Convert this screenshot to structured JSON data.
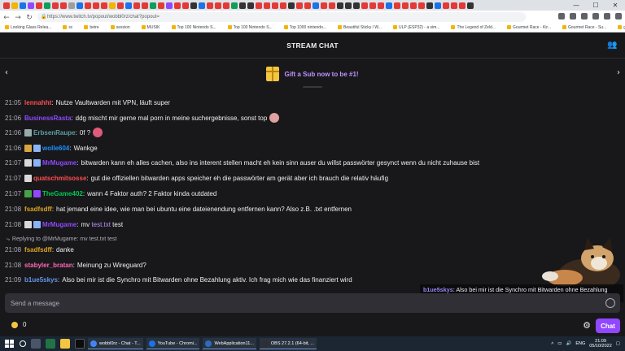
{
  "browser": {
    "url": "https://www.twitch.tv/popout/wobbl0rz/chat?popout=",
    "bookmarks": [
      "Looking Glass Relea...",
      "sc",
      "betre",
      "session",
      "MUSIK",
      "Top 100 Nintendo S...",
      "Top 100 Nintendo S...",
      "Top 1000 nintendo...",
      "Beautiful Sticky / W...",
      "ULP (ESP32) - a sim...",
      "The Legend of Zeld...",
      "Gourmet Race - Kir...",
      "Gourmet Race - Su...",
      "gachibass gif - Goo..."
    ]
  },
  "header": {
    "title": "STREAM CHAT"
  },
  "banner": {
    "text": "Gift a Sub now to be #1!"
  },
  "messages": [
    {
      "time": "21:05",
      "user": "lennahht",
      "color": "#ff4d4d",
      "text": "Nutze Vaultwarden mit VPN, läuft super",
      "badges": []
    },
    {
      "time": "21:06",
      "user": "BusinessRasta",
      "color": "#9147ff",
      "text": "ddg mischt mir gerne mal porn in meine suchergebnisse, sonst top",
      "badges": [],
      "emote": "#e0a0a0"
    },
    {
      "time": "21:06",
      "user": "ErbsenRaupe",
      "color": "#5f9ea0",
      "text": "0f ?",
      "badges": [
        "#9aa"
      ],
      "emote": "#e05a7a"
    },
    {
      "time": "21:06",
      "user": "wolle604",
      "color": "#1e90ff",
      "text": "Wankge",
      "badges": [
        "#d9a441",
        "#8ab4f8"
      ]
    },
    {
      "time": "21:07",
      "user": "MrMugame",
      "color": "#9147ff",
      "text": "bitwarden kann eh alles cachen, also ins interent stellen macht eh kein sinn auser du willst passwörter gesynct wenn du nicht zuhause bist",
      "badges": [
        "#d9d9d9",
        "#8ab4f8"
      ]
    },
    {
      "time": "21:07",
      "user": "quatschmitsosse",
      "color": "#ff4d4d",
      "text": "gut die offiziellen bitwarden apps speicher eh die passwörter am gerät aber ich brauch die relativ häufig",
      "badges": [
        "#d9d9d9"
      ]
    },
    {
      "time": "21:07",
      "user": "TheGame402",
      "color": "#00c853",
      "text": "wann 4 Faktor auth? 2 Faktor kinda outdated",
      "badges": [
        "#45a245",
        "#9147ff"
      ]
    },
    {
      "time": "21:08",
      "user": "fsadfsdff",
      "color": "#daa520",
      "text": "hat jemand eine idee, wie man bei ubuntu eine dateienendung entfernen kann? Also z.B. .txt entfernen",
      "badges": []
    },
    {
      "time": "21:08",
      "user": "MrMugame",
      "color": "#9147ff",
      "text_pre": "mv ",
      "link": "test.txt",
      "text_post": " test",
      "badges": [
        "#d9d9d9",
        "#8ab4f8"
      ]
    },
    {
      "time": "21:08",
      "user": "fsadfsdff",
      "color": "#daa520",
      "text": "danke",
      "badges": [],
      "reply": "Replying to @MrMugame: mv test.txt test"
    },
    {
      "time": "21:08",
      "user": "stabyler_bratan",
      "color": "#ff69b4",
      "text": "Meinung zu Wireguard?",
      "badges": []
    },
    {
      "time": "21:09",
      "user": "b1ue5skys",
      "color": "#6495ed",
      "text": "Also bei mir ist die Synchro mit Bitwarden ohne Bezahlung aktiv. Ich frag mich wie das finanziert wird",
      "badges": []
    }
  ],
  "tooltip": {
    "user": "b1ue5skys",
    "text": ": Also bei mir ist die Synchro mit Bitwarden ohne Bezahlung aktiv. Ich frag mich wie das finanziert wird"
  },
  "input": {
    "placeholder": "Send a message"
  },
  "footer": {
    "points": "0",
    "chat_button": "Chat"
  },
  "taskbar": {
    "apps": [
      "wobbl0rz - Chat - T...",
      "YouTube - Chromi...",
      "WebApplication11...",
      "OBS 27.2.1 (64-bit, ..."
    ],
    "lang": "ENG",
    "time": "21:09",
    "date": "05/10/2022"
  }
}
